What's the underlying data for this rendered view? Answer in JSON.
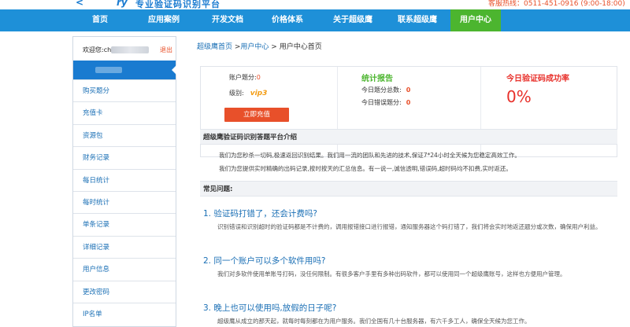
{
  "header": {
    "logo_arrow": "<",
    "logo_mark": "ry",
    "slogan": "专业验证码识别平台",
    "hotline": "客服热线：0511-451-0916 (9:00-18:00)"
  },
  "nav": {
    "items": [
      {
        "label": "首页"
      },
      {
        "label": "应用案例"
      },
      {
        "label": "开发文档"
      },
      {
        "label": "价格体系"
      },
      {
        "label": "关于超级鹰"
      },
      {
        "label": "联系超级鹰"
      },
      {
        "label": "用户中心"
      }
    ],
    "active_index": 6
  },
  "sidebar": {
    "welcome": "欢迎您:ch",
    "logout": "退出",
    "items": [
      {
        "label": "购买题分"
      },
      {
        "label": "充值卡"
      },
      {
        "label": "资源包"
      },
      {
        "label": "财务记录"
      },
      {
        "label": "每日统计"
      },
      {
        "label": "每时统计"
      },
      {
        "label": "单条记录"
      },
      {
        "label": "详细记录"
      },
      {
        "label": "用户信息"
      },
      {
        "label": "更改密码"
      },
      {
        "label": "IP名单"
      }
    ]
  },
  "breadcrumb": {
    "home": "超级鹰首页",
    "sep1": " >",
    "center": "用户中心",
    "sep2": " > ",
    "current": "用户中心首页"
  },
  "account": {
    "points_label": "账户题分:",
    "points_value": "0",
    "level_label": "级别:",
    "level_badge": "vip3",
    "recharge": "立即充值"
  },
  "report": {
    "title": "统计报告",
    "total_label": "今日题分总数:",
    "total_value": "0",
    "error_label": "今日错误题分:",
    "error_value": "0"
  },
  "success": {
    "title": "今日验证码成功率",
    "percent": "0%"
  },
  "intro": {
    "title": "超级鹰验证码识别答题平台介绍",
    "p1": "我们为您秒杀一切码,极速返回识别结果。我们用一流的团队和先进的技术,保证7*24小时全天候为您稳定高效工作。",
    "p2": "我们为您提供实时精确的出码记录,按时按天的汇总信息。有一说一,诚信透明,错误码,超时码均不扣费,实时返还。"
  },
  "faq": {
    "title": "常见问题:",
    "items": [
      {
        "q": "1. 验证码打错了，还会计费吗?",
        "a": "识别错误和识别超时的验证码都是不计费的，调用报错接口进行报错，通知服务器这个码打错了，我们将会实时地返还题分或次数，确保用户利益。"
      },
      {
        "q": "2. 同一个账户可以多个软件用吗?",
        "a": "我们对多软件使用单账号打码，没任何限制。有很多客户手里有多种出码软件，都可以使用同一个超级鹰账号，这样也方便用户管理。"
      },
      {
        "q": "3. 晚上也可以使用吗,放假的日子呢?",
        "a": "超级鹰从成立的那天起，就每时每刻都在为用户服务。我们全国有几十台服务器，有六千多工人，确保全天候为您工作。"
      }
    ]
  },
  "colors": {
    "nav_blue": "#1e90d8",
    "active_green": "#4cb52f",
    "accent_red": "#e8502a",
    "link_blue": "#1a6fb5"
  }
}
